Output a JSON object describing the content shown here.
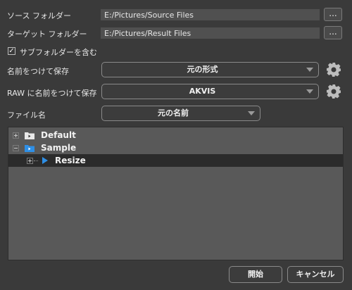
{
  "source": {
    "label": "ソース フォルダー",
    "value": "E:/Pictures/Source Files",
    "browse": "..."
  },
  "target": {
    "label": "ターゲット フォルダー",
    "value": "E:/Pictures/Result Files",
    "browse": "..."
  },
  "subfolders": {
    "label": "サブフォルダーを含む",
    "checked": true,
    "mark": "✓"
  },
  "save_as": {
    "label": "名前をつけて保存",
    "value": "元の形式"
  },
  "raw_save_as": {
    "label": "RAW に名前をつけて保存",
    "value": "AKVIS"
  },
  "file_name": {
    "label": "ファイル名",
    "value": "元の名前"
  },
  "tree": {
    "items": [
      {
        "label": "Default",
        "expanded": false
      },
      {
        "label": "Sample",
        "expanded": true
      },
      {
        "label": "Resize",
        "selected": true
      }
    ]
  },
  "buttons": {
    "start": "開始",
    "cancel": "キャンセル"
  },
  "colors": {
    "accent": "#2e8fe6",
    "selection": "#2b2b2b"
  }
}
